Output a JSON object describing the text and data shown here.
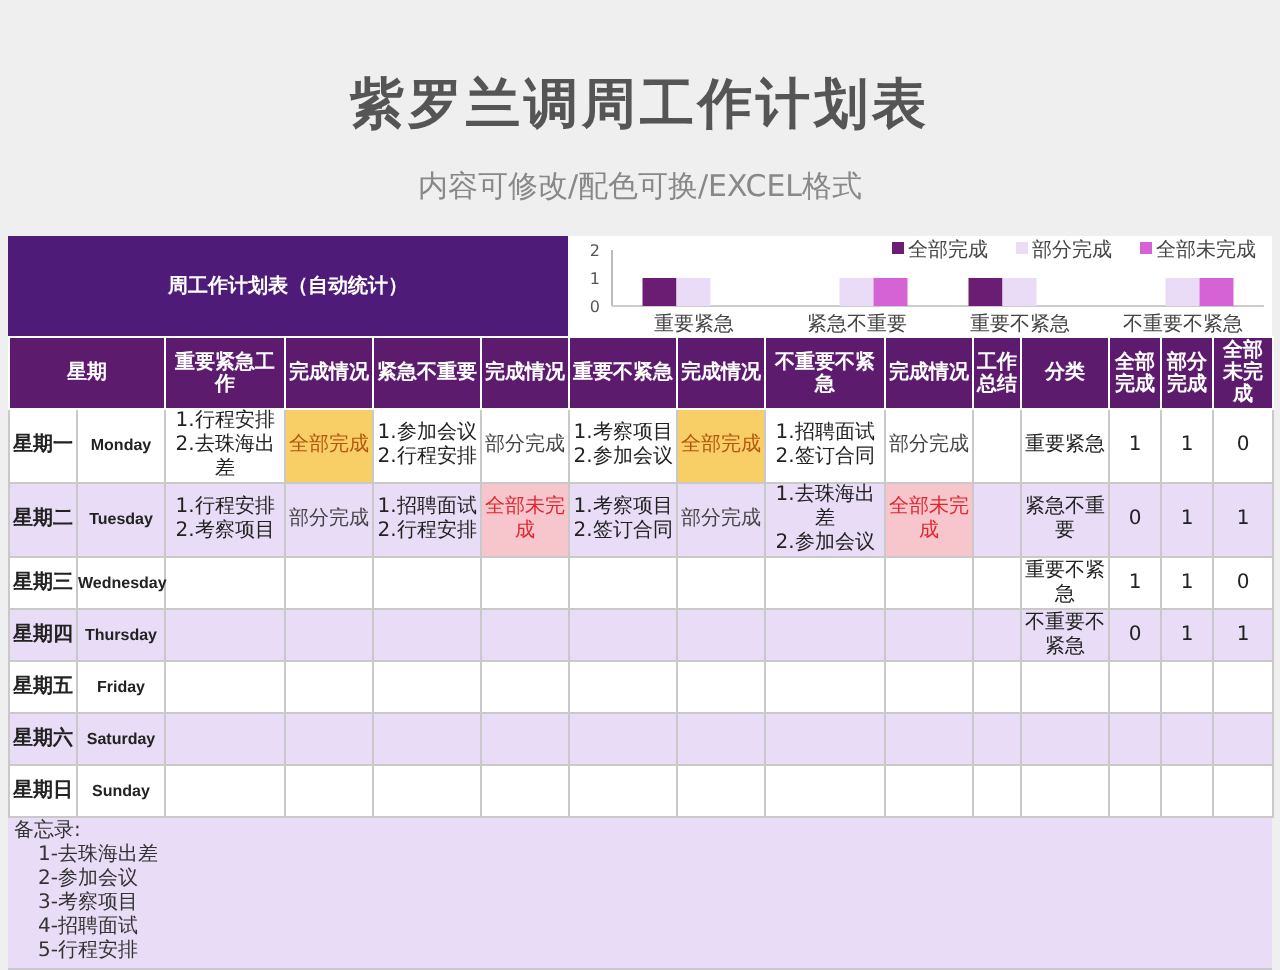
{
  "page": {
    "title": "紫罗兰调周工作计划表",
    "subtitle": "内容可修改/配色可换/EXCEL格式"
  },
  "sheet": {
    "title": "周工作计划表（自动统计）",
    "chart_data": {
      "type": "bar",
      "categories": [
        "重要紧急",
        "紧急不重要",
        "重要不紧急",
        "不重要不紧急"
      ],
      "series": [
        {
          "name": "全部完成",
          "color": "#6b1d73",
          "values": [
            1,
            0,
            1,
            0
          ]
        },
        {
          "name": "部分完成",
          "color": "#eadcf7",
          "values": [
            1,
            1,
            1,
            1
          ]
        },
        {
          "name": "全部未完成",
          "color": "#d563d6",
          "values": [
            0,
            1,
            0,
            1
          ]
        }
      ],
      "ylim": [
        0,
        2
      ],
      "yticks": [
        0,
        1,
        2
      ],
      "legend": "top-right"
    },
    "headers": [
      {
        "label": "星期"
      },
      {
        "label": "重要紧急工作"
      },
      {
        "label": "完成情况"
      },
      {
        "label": "紧急不重要"
      },
      {
        "label": "完成情况"
      },
      {
        "label": "重要不紧急"
      },
      {
        "label": "完成情况"
      },
      {
        "label": "不重要不紧急"
      },
      {
        "label": "完成情况"
      },
      {
        "label": "工作总结"
      },
      {
        "label": "分类"
      },
      {
        "label": "全部完成"
      },
      {
        "label": "部分完成"
      },
      {
        "label": "全部未完成"
      }
    ],
    "rows": [
      {
        "day": "星期一",
        "day_en": "Monday",
        "quadrants": [
          {
            "tasks": [
              "1.行程安排",
              "2.去珠海出差"
            ],
            "status": {
              "text": "全部完成",
              "kind": "done"
            }
          },
          {
            "tasks": [
              "1.参加会议",
              "2.行程安排"
            ],
            "status": {
              "text": "部分完成",
              "kind": "partial"
            }
          },
          {
            "tasks": [
              "1.考察项目",
              "2.参加会议"
            ],
            "status": {
              "text": "全部完成",
              "kind": "done"
            }
          },
          {
            "tasks": [
              "1.招聘面试",
              "2.签订合同"
            ],
            "status": {
              "text": "部分完成",
              "kind": "partial"
            }
          }
        ],
        "stats": {
          "category": "重要紧急",
          "values": [
            "1",
            "1",
            "0"
          ]
        }
      },
      {
        "day": "星期二",
        "day_en": "Tuesday",
        "quadrants": [
          {
            "tasks": [
              "1.行程安排",
              "2.考察项目"
            ],
            "status": {
              "text": "部分完成",
              "kind": "partial"
            }
          },
          {
            "tasks": [
              "1.招聘面试",
              "2.行程安排"
            ],
            "status": {
              "text": "全部未完成",
              "kind": "none"
            }
          },
          {
            "tasks": [
              "1.考察项目",
              "2.签订合同"
            ],
            "status": {
              "text": "部分完成",
              "kind": "partial"
            }
          },
          {
            "tasks": [
              "1.去珠海出差",
              "2.参加会议"
            ],
            "status": {
              "text": "全部未完成",
              "kind": "none"
            }
          }
        ],
        "stats": {
          "category": "紧急不重要",
          "values": [
            "0",
            "1",
            "1"
          ]
        }
      },
      {
        "day": "星期三",
        "day_en": "Wednesday",
        "stats": {
          "category": "重要不紧急",
          "values": [
            "1",
            "1",
            "0"
          ]
        }
      },
      {
        "day": "星期四",
        "day_en": "Thursday",
        "stats": {
          "category": "不重要不紧急",
          "values": [
            "0",
            "1",
            "1"
          ]
        }
      },
      {
        "day": "星期五",
        "day_en": "Friday"
      },
      {
        "day": "星期六",
        "day_en": "Saturday"
      },
      {
        "day": "星期日",
        "day_en": "Sunday"
      }
    ],
    "memo": {
      "title": "备忘录:",
      "items": [
        "1-去珠海出差",
        "2-参加会议",
        "3-考察项目",
        "4-招聘面试",
        "5-行程安排"
      ]
    }
  }
}
